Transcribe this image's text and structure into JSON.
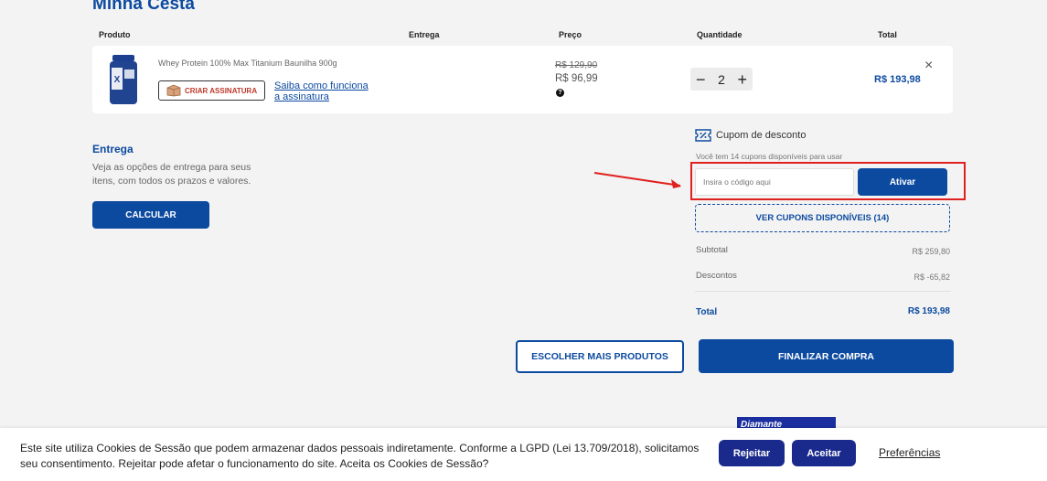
{
  "page": {
    "title": "Minha Cesta"
  },
  "table_headers": {
    "produto": "Produto",
    "entrega": "Entrega",
    "preco": "Preço",
    "quantidade": "Quantidade",
    "total": "Total"
  },
  "cart_item": {
    "name": "Whey Protein 100% Max Titanium Baunilha 900g",
    "subscribe_label": "CRIAR ASSINATURA",
    "subscribe_link": "Saiba como funciona a assinatura",
    "old_price": "R$ 129,90",
    "price": "R$ 96,99",
    "help_icon": "?",
    "quantity": "2",
    "minus": "−",
    "plus": "+",
    "total": "R$ 193,98",
    "remove": "×"
  },
  "delivery": {
    "title": "Entrega",
    "text": "Veja as opções de entrega para seus itens, com todos os prazos e valores.",
    "button": "CALCULAR"
  },
  "coupon": {
    "icon": "coupon-icon",
    "title": "Cupom de desconto",
    "available_text": "Você tem 14 cupons disponíveis para usar",
    "placeholder": "Insira o código aqui",
    "apply_button": "Ativar",
    "view_button": "VER CUPONS DISPONÍVEIS (14)"
  },
  "summary": {
    "subtotal_label": "Subtotal",
    "subtotal_value": "R$ 259,80",
    "discount_label": "Descontos",
    "discount_value": "R$ -65,82",
    "total_label": "Total",
    "total_value": "R$ 193,98"
  },
  "actions": {
    "more_products": "ESCOLHER MAIS PRODUTOS",
    "checkout": "FINALIZAR COMPRA"
  },
  "banner": {
    "text": "Diamante"
  },
  "cookie": {
    "text": "Este site utiliza Cookies de Sessão que podem armazenar dados pessoais indiretamente. Conforme a LGPD (Lei 13.709/2018), solicitamos seu consentimento. Rejeitar pode afetar o funcionamento do site. Aceita os Cookies de Sessão?",
    "reject": "Rejeitar",
    "accept": "Aceitar",
    "preferences": "Preferências"
  },
  "colors": {
    "brand": "#0c4aa0",
    "annotation_red": "#e0201f",
    "cookie_buttons": "#1a2a8c"
  }
}
